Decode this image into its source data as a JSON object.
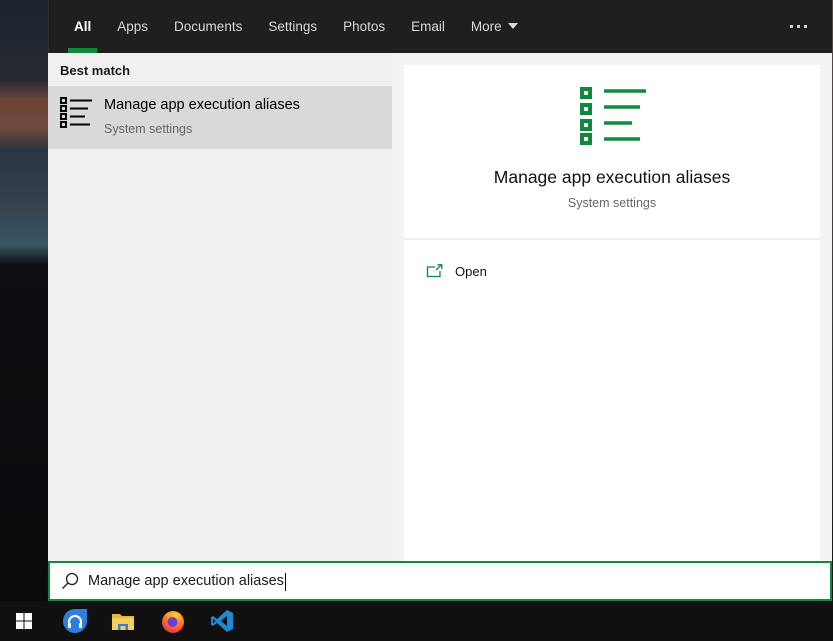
{
  "header": {
    "tabs": [
      {
        "label": "All",
        "active": true
      },
      {
        "label": "Apps"
      },
      {
        "label": "Documents"
      },
      {
        "label": "Settings"
      },
      {
        "label": "Photos"
      },
      {
        "label": "Email"
      },
      {
        "label": "More",
        "dropdown": true
      }
    ],
    "more_options_icon": "ellipsis-icon"
  },
  "results": {
    "section_label": "Best match",
    "items": [
      {
        "title": "Manage app execution aliases",
        "subtitle": "System settings",
        "icon": "list-settings-icon",
        "selected": true
      }
    ]
  },
  "preview": {
    "title": "Manage app execution aliases",
    "subtitle": "System settings",
    "icon": "list-settings-icon",
    "actions": [
      {
        "label": "Open",
        "icon": "open-external-icon"
      }
    ]
  },
  "search": {
    "value": "Manage app execution aliases",
    "icon": "search-icon"
  },
  "taskbar": {
    "items": [
      {
        "name": "start",
        "icon": "windows-logo-icon"
      },
      {
        "name": "music-app",
        "icon": "headphones-icon"
      },
      {
        "name": "file-explorer",
        "icon": "folder-icon"
      },
      {
        "name": "firefox",
        "icon": "firefox-icon"
      },
      {
        "name": "vscode",
        "icon": "vscode-icon"
      }
    ]
  },
  "colors": {
    "accent": "#10893e",
    "header_bg": "#1f1f1f",
    "selected_row": "#d9d9d9",
    "taskbar_bg": "#101010"
  }
}
